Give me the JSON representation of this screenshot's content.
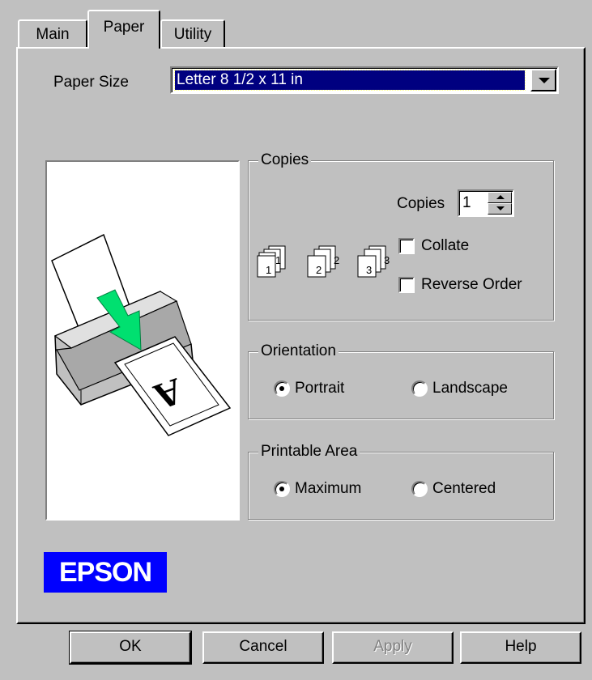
{
  "tabs": [
    {
      "label": "Main"
    },
    {
      "label": "Paper"
    },
    {
      "label": "Utility"
    }
  ],
  "paper_size": {
    "label": "Paper Size",
    "value": "Letter 8 1/2 x 11 in"
  },
  "copies": {
    "group_label": "Copies",
    "copies_label": "Copies",
    "copies_value": "1",
    "collate_label": "Collate",
    "collate_checked": false,
    "reverse_label": "Reverse Order",
    "reverse_checked": false,
    "icons": [
      "1",
      "2",
      "3"
    ]
  },
  "orientation": {
    "group_label": "Orientation",
    "portrait_label": "Portrait",
    "landscape_label": "Landscape",
    "selected": "Portrait"
  },
  "printable_area": {
    "group_label": "Printable Area",
    "maximum_label": "Maximum",
    "centered_label": "Centered",
    "selected": "Maximum"
  },
  "logo_text": "EPSON",
  "buttons": {
    "ok": "OK",
    "cancel": "Cancel",
    "apply": "Apply",
    "help": "Help"
  },
  "colors": {
    "face": "#c0c0c0",
    "selection": "#000080",
    "logo_bg": "#0000ff",
    "arrow": "#00e070"
  }
}
